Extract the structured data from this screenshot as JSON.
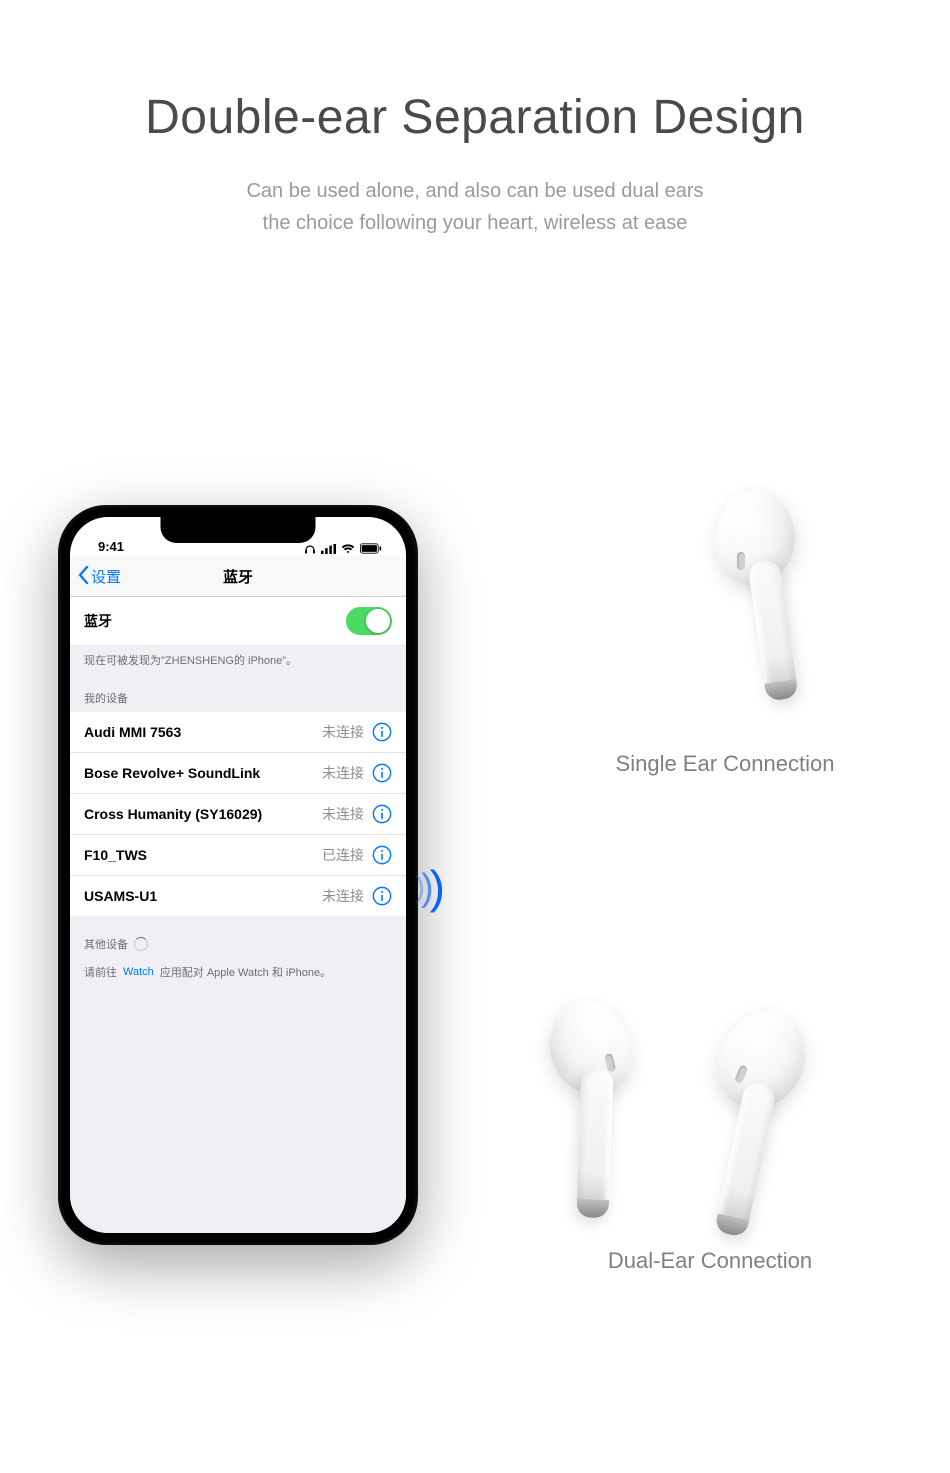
{
  "hero": {
    "title": "Double-ear Separation Design",
    "sub1": "Can be used alone, and also can be used dual ears",
    "sub2": "the choice following your heart, wireless at ease"
  },
  "phone": {
    "statusbar": {
      "time": "9:41"
    },
    "nav": {
      "back": "设置",
      "title": "蓝牙"
    },
    "bluetooth": {
      "label": "蓝牙",
      "discoverable": "现在可被发现为\"ZHENSHENG的 iPhone\"。",
      "myDevicesHeader": "我的设备",
      "devices": [
        {
          "name": "Audi MMI 7563",
          "status": "未连接"
        },
        {
          "name": "Bose Revolve+ SoundLink",
          "status": "未连接"
        },
        {
          "name": "Cross Humanity (SY16029)",
          "status": "未连接"
        },
        {
          "name": "F10_TWS",
          "status": "已连接"
        },
        {
          "name": "USAMS-U1",
          "status": "未连接"
        }
      ],
      "otherHeader": "其他设备",
      "footerPrefix": "请前往 ",
      "footerLink": "Watch",
      "footerSuffix": " 应用配对 Apple Watch 和 iPhone。"
    }
  },
  "captions": {
    "single": "Single Ear Connection",
    "dual": "Dual-Ear Connection"
  }
}
